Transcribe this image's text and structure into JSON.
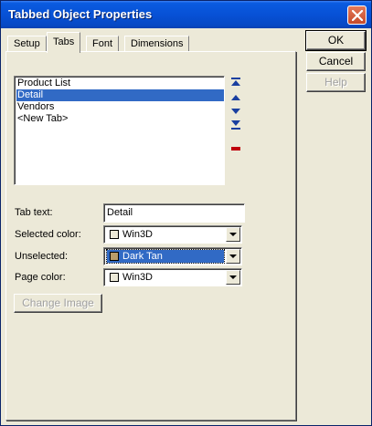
{
  "window": {
    "title": "Tabbed Object Properties"
  },
  "tabs": [
    {
      "label": "Setup"
    },
    {
      "label": "Tabs"
    },
    {
      "label": "Font"
    },
    {
      "label": "Dimensions"
    }
  ],
  "tab_list": {
    "items": [
      {
        "label": "Product List"
      },
      {
        "label": "Detail"
      },
      {
        "label": "Vendors"
      },
      {
        "label": "<New Tab>"
      }
    ],
    "selected": "Detail"
  },
  "form": {
    "tab_text_label": "Tab text:",
    "tab_text_value": "Detail",
    "selected_color_label": "Selected color:",
    "selected_color_value": "Win3D",
    "unselected_label": "Unselected:",
    "unselected_value": "Dark Tan",
    "page_color_label": "Page color:",
    "page_color_value": "Win3D"
  },
  "buttons": {
    "ok": "OK",
    "cancel": "Cancel",
    "help": "Help",
    "change_image": "Change Image"
  },
  "colors": {
    "win3d": "#ece9d8",
    "dark_tan": "#b89c6a",
    "selection": "#316ac5",
    "delete_icon": "#c0000c",
    "move_icons": "#1a3fa0"
  }
}
